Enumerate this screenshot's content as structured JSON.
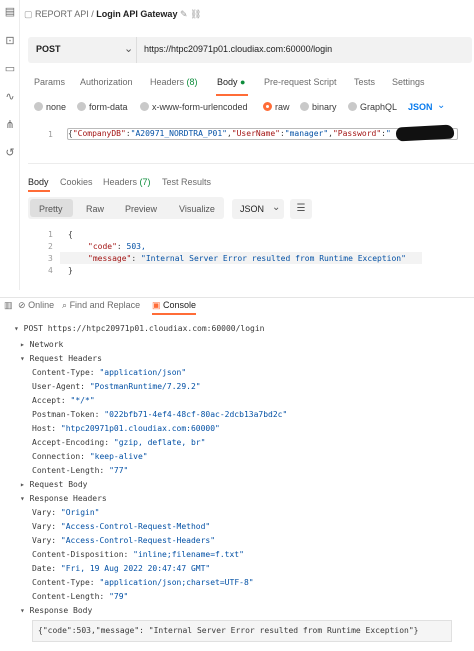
{
  "breadcrumb": {
    "collection": "REPORT API",
    "separator": "/",
    "request": "Login API Gateway"
  },
  "request": {
    "method": "POST",
    "url": "https://htpc20971p01.cloudiax.com:60000/login"
  },
  "tabs": [
    {
      "label": "Params"
    },
    {
      "label": "Authorization"
    },
    {
      "label": "Headers",
      "badge": "(8)"
    },
    {
      "label": "Body",
      "badge": "●"
    },
    {
      "label": "Pre-request Script"
    },
    {
      "label": "Tests"
    },
    {
      "label": "Settings"
    }
  ],
  "body_options": {
    "none": "none",
    "form_data": "form-data",
    "urlencoded": "x-www-form-urlencoded",
    "raw": "raw",
    "binary": "binary",
    "graphql": "GraphQL",
    "format": "JSON",
    "selected": "raw"
  },
  "request_body": {
    "line": "1",
    "k1": "\"CompanyDB\"",
    "v1": "\"A20971_NORDTRA_P01\"",
    "k2": "\"UserName\"",
    "v2": "\"manager\"",
    "k3": "\"Password\"",
    "v3": "\""
  },
  "response_tabs": {
    "body": "Body",
    "cookies": "Cookies",
    "headers": "Headers",
    "headers_count": "(7)",
    "results": "Test Results"
  },
  "response_format": {
    "pretty": "Pretty",
    "raw": "Raw",
    "preview": "Preview",
    "visualize": "Visualize",
    "type": "JSON"
  },
  "response_body": {
    "lines": [
      "1",
      "2",
      "3",
      "4"
    ],
    "open": "{",
    "k1": "\"code\"",
    "v1": "503,",
    "k2": "\"message\"",
    "v2": "\"Internal Server Error resulted from Runtime Exception\"",
    "close": "}"
  },
  "console_tabs": {
    "online": "Online",
    "find": "Find and Replace",
    "console": "Console"
  },
  "console": {
    "entry": "POST https://htpc20971p01.cloudiax.com:60000/login",
    "network": "Network",
    "request_headers": "Request Headers",
    "req_headers": [
      {
        "k": "Content-Type:",
        "v": "\"application/json\""
      },
      {
        "k": "User-Agent:",
        "v": "\"PostmanRuntime/7.29.2\""
      },
      {
        "k": "Accept:",
        "v": "\"*/*\""
      },
      {
        "k": "Postman-Token:",
        "v": "\"022bfb71-4ef4-48cf-80ac-2dcb13a7bd2c\""
      },
      {
        "k": "Host:",
        "v": "\"htpc20971p01.cloudiax.com:60000\""
      },
      {
        "k": "Accept-Encoding:",
        "v": "\"gzip, deflate, br\""
      },
      {
        "k": "Connection:",
        "v": "\"keep-alive\""
      },
      {
        "k": "Content-Length:",
        "v": "\"77\""
      }
    ],
    "request_body": "Request Body",
    "response_headers": "Response Headers",
    "resp_headers": [
      {
        "k": "Vary:",
        "v": "\"Origin\""
      },
      {
        "k": "Vary:",
        "v": "\"Access-Control-Request-Method\""
      },
      {
        "k": "Vary:",
        "v": "\"Access-Control-Request-Headers\""
      },
      {
        "k": "Content-Disposition:",
        "v": "\"inline;filename=f.txt\""
      },
      {
        "k": "Date:",
        "v": "\"Fri, 19 Aug 2022 20:47:47 GMT\""
      },
      {
        "k": "Content-Type:",
        "v": "\"application/json;charset=UTF-8\""
      },
      {
        "k": "Content-Length:",
        "v": "\"79\""
      }
    ],
    "response_body": "Response Body",
    "response_body_text": "{\"code\":503,\"message\": \"Internal Server Error resulted from Runtime Exception\"}"
  },
  "colors": {
    "accent": "#ff6c37",
    "link": "#097bed",
    "ok": "#0d8c3b"
  }
}
